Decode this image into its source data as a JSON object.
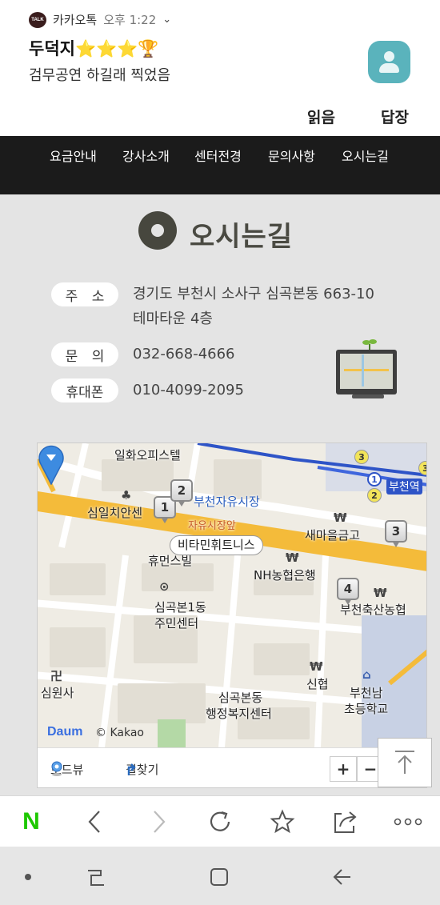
{
  "notification": {
    "app_badge": "TALK",
    "app_name": "카카오톡",
    "time": "오후 1:22",
    "title": "두덕지⭐⭐⭐🏆",
    "message": "검무공연 하길래 찍었음",
    "actions": {
      "read": "읽음",
      "reply": "답장"
    }
  },
  "site_nav": {
    "items": [
      "요금안내",
      "강사소개",
      "센터전경",
      "문의사항",
      "오시는길"
    ]
  },
  "section": {
    "title": "오시는길",
    "address_label": "주 소",
    "address_line1": "경기도 부천시 소사구 심곡본동 663-10",
    "address_line2": "테마타운 4층",
    "inquiry_label": "문 의",
    "inquiry_value": "032-668-4666",
    "mobile_label": "휴대폰",
    "mobile_value": "010-4099-2095"
  },
  "map": {
    "labels": {
      "office": "일화오피스텔",
      "market": "부천자유시장",
      "market_front": "자유시장앞",
      "shin_il": "심일치안센",
      "saemaul": "새마을금고",
      "human": "휴먼스빌",
      "callout": "비타민휘트니스",
      "nh_bank": "NH농협은행",
      "dong_center_1": "심곡본1동",
      "dong_center_2": "주민센터",
      "livestock": "부천축산농협",
      "temple": "심원사",
      "shinhyup": "신협",
      "admin_1": "심곡본동",
      "admin_2": "행정복지센터",
      "school_1": "부천남",
      "school_2": "초등학교",
      "station": "부천역"
    },
    "markers": [
      "1",
      "2",
      "3",
      "4"
    ],
    "subway_numbers": [
      "1",
      "2",
      "3"
    ],
    "brand": "Daum",
    "copyright": "© Kakao",
    "roadview": "로드뷰",
    "directions": "길찾기",
    "zoom_in": "+",
    "zoom_out": "−"
  },
  "browser": {
    "naver": "N"
  },
  "colors": {
    "road_main": "#f4bb3a",
    "pin": "#3d8be0",
    "nav_bg": "#1b1b1b",
    "naver_green": "#1ec800",
    "avatar": "#5ab3bc"
  }
}
